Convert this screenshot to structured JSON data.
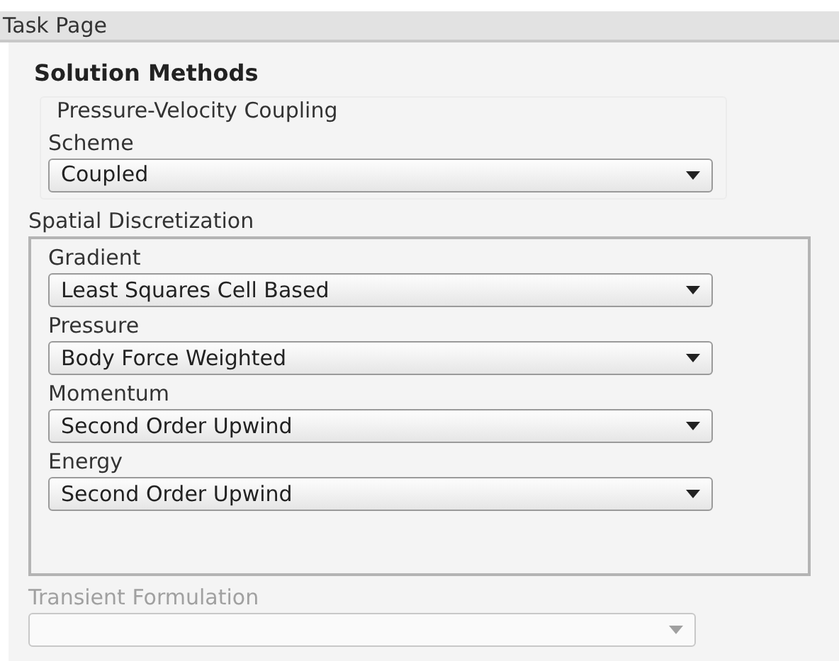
{
  "window": {
    "title": "Task Page"
  },
  "heading": "Solution Methods",
  "coupling": {
    "title": "Pressure-Velocity Coupling",
    "fields": [
      {
        "label": "Scheme",
        "value": "Coupled",
        "disabled": false
      }
    ]
  },
  "spatial": {
    "title": "Spatial Discretization",
    "fields": [
      {
        "label": "Gradient",
        "value": "Least Squares Cell Based",
        "disabled": false
      },
      {
        "label": "Pressure",
        "value": "Body Force Weighted",
        "disabled": false
      },
      {
        "label": "Momentum",
        "value": "Second Order Upwind",
        "disabled": false
      },
      {
        "label": "Energy",
        "value": "Second Order Upwind",
        "disabled": false
      }
    ]
  },
  "transient": {
    "label": "Transient Formulation",
    "disabled": true
  }
}
